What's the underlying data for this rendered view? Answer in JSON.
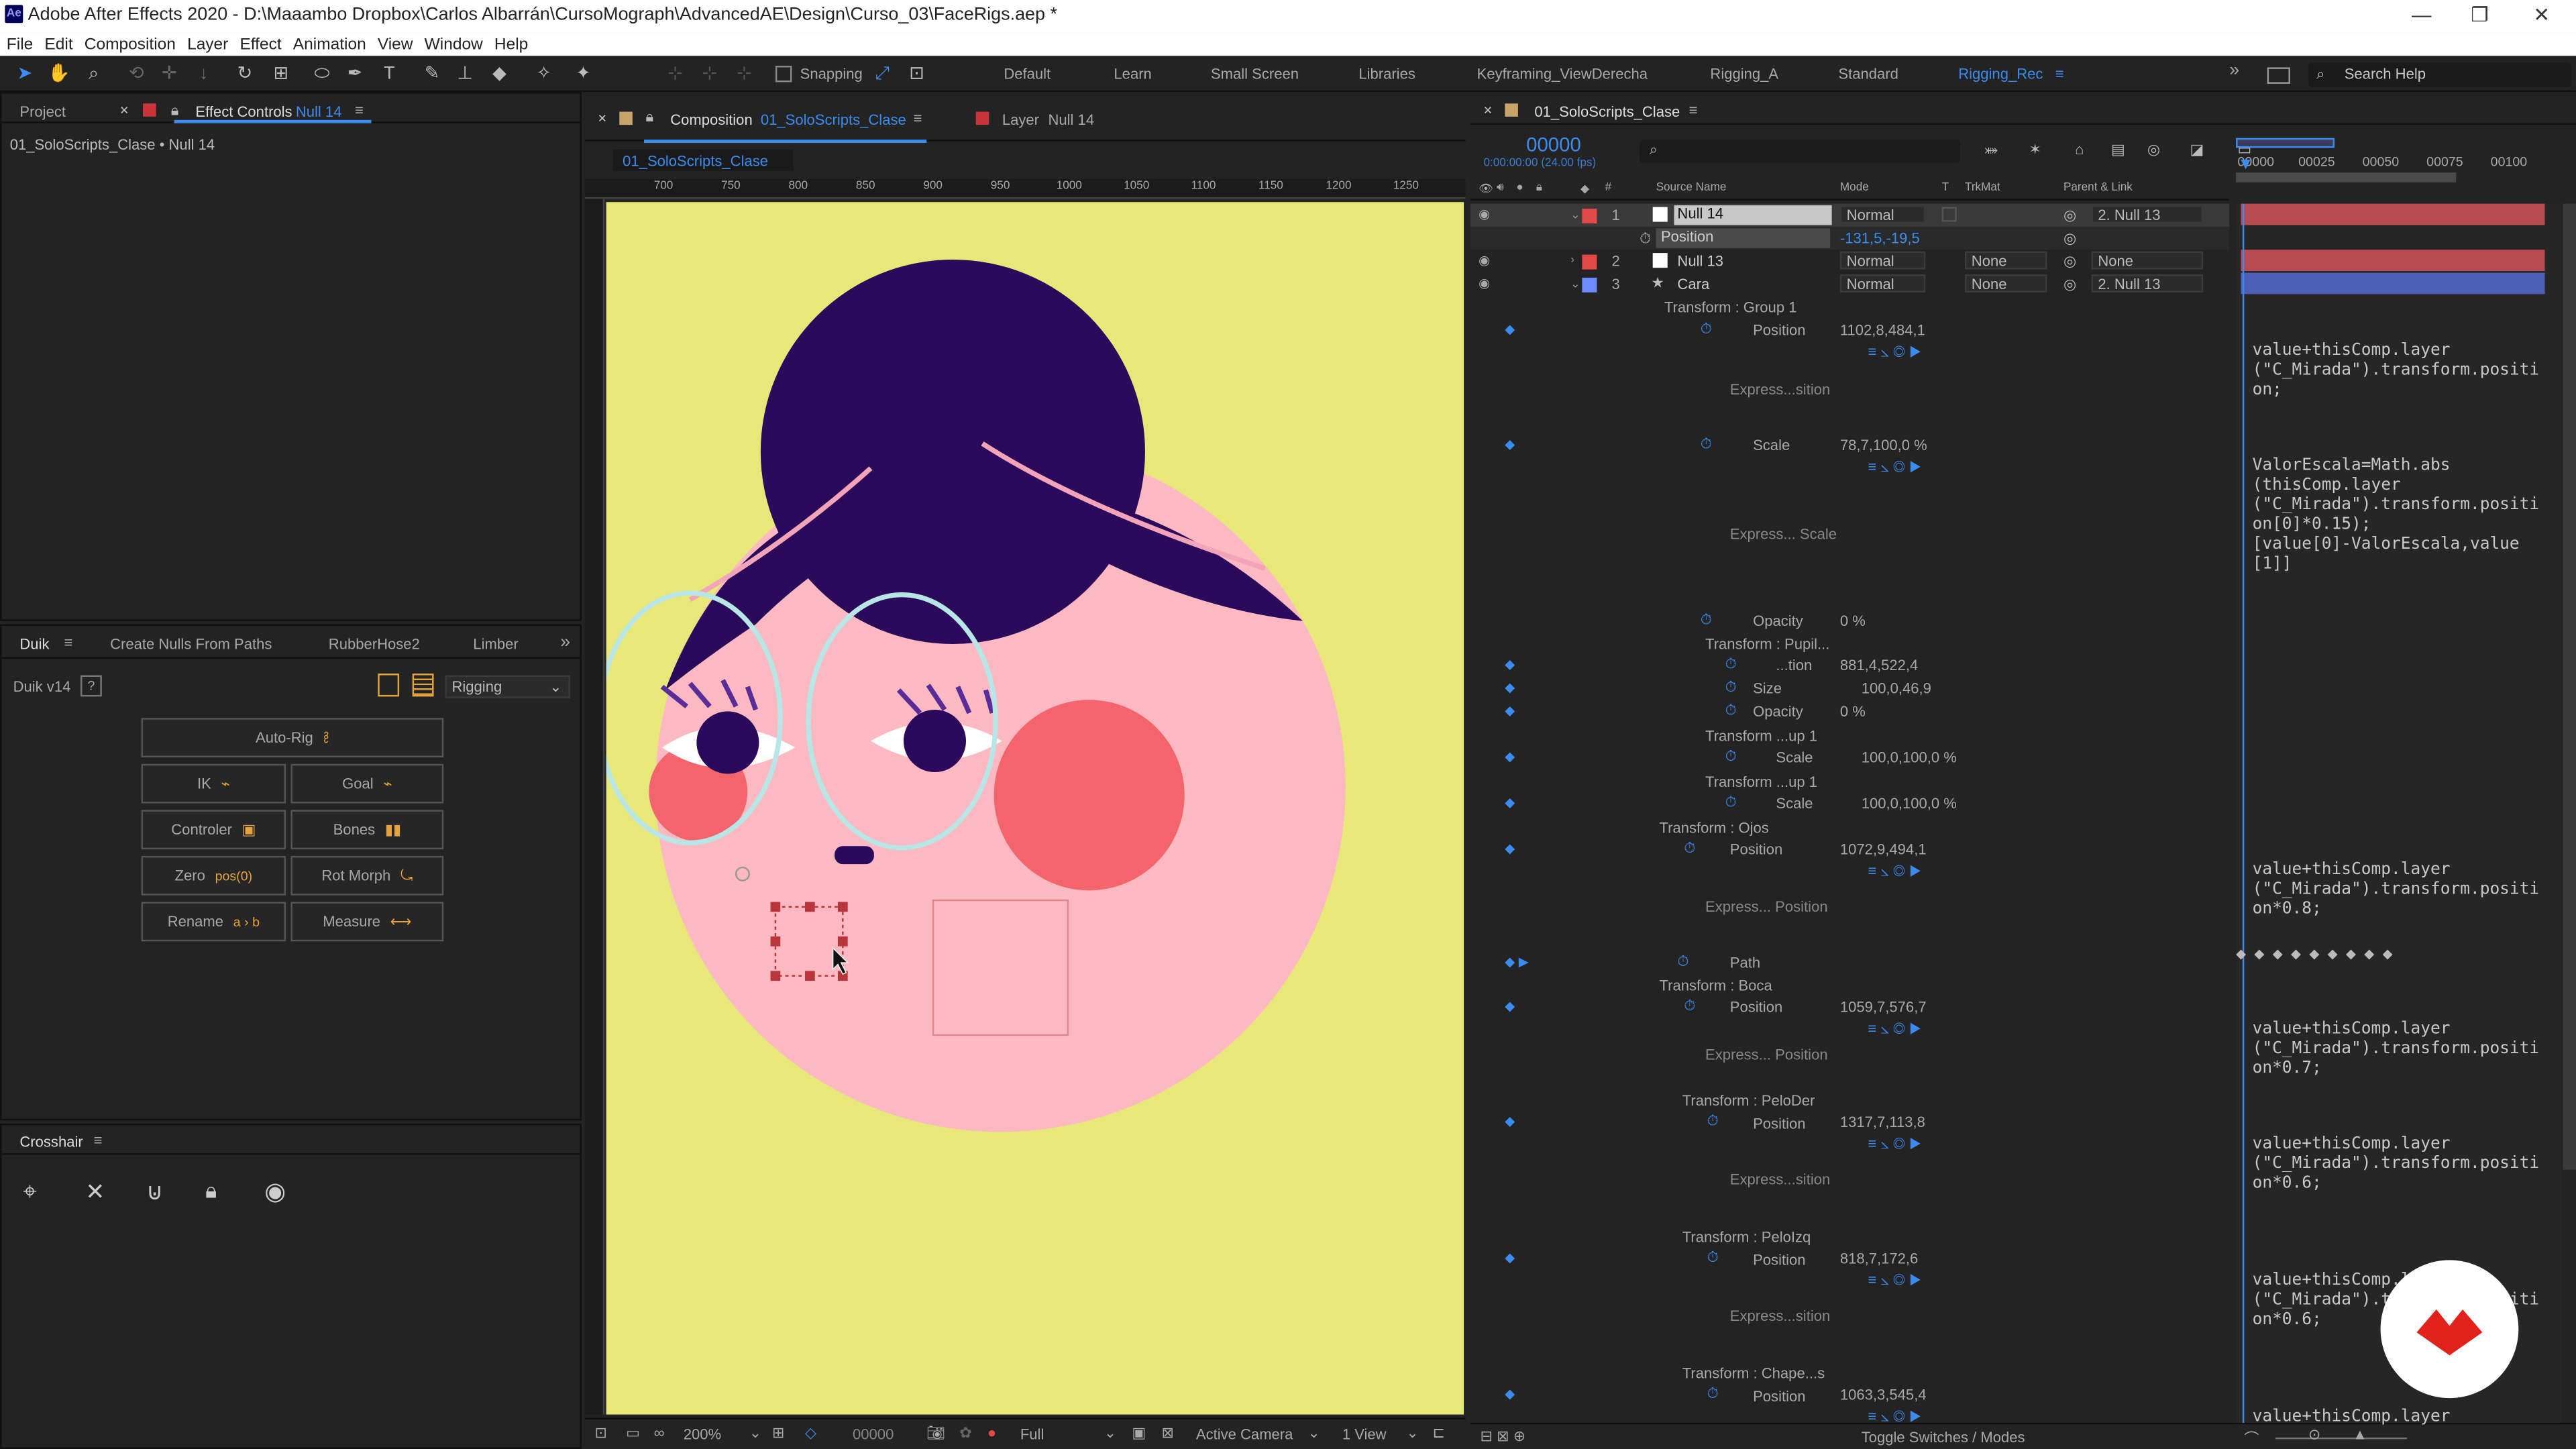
{
  "app": {
    "title": "Adobe After Effects 2020 - D:\\Maaambo Dropbox\\Carlos Albarrán\\CursoMograph\\AdvancedAE\\Design\\Curso_03\\FaceRigs.aep *",
    "logo": "Ae"
  },
  "menu": [
    "File",
    "Edit",
    "Composition",
    "Layer",
    "Effect",
    "Animation",
    "View",
    "Window",
    "Help"
  ],
  "toolbar": {
    "snapping": "Snapping",
    "workspaces": [
      "Default",
      "Learn",
      "Small Screen",
      "Libraries",
      "Keyframing_ViewDerecha",
      "Rigging_A",
      "Standard",
      "Rigging_Rec"
    ],
    "active_workspace": "Rigging_Rec",
    "search_placeholder": "Search Help"
  },
  "left_panel": {
    "tab_project": "Project",
    "tab_effect_controls": "Effect Controls",
    "effect_controls_layer": "Null 14",
    "breadcrumb": "01_SoloScripts_Clase • Null 14"
  },
  "duik": {
    "tabs": [
      "Duik",
      "Create Nulls From Paths",
      "RubberHose2",
      "Limber"
    ],
    "version": "Duik v14",
    "help": "?",
    "mode": "Rigging",
    "buttons": [
      {
        "label": "Auto-Rig",
        "icon": "ꔧ"
      },
      {
        "label": "IK",
        "icon": "⌁"
      },
      {
        "label": "Goal",
        "icon": "⌁"
      },
      {
        "label": "Controler",
        "icon": "▣"
      },
      {
        "label": "Bones",
        "icon": "▮▮"
      },
      {
        "label": "Zero",
        "icon": "pos(0)"
      },
      {
        "label": "Rot Morph",
        "icon": "⤿"
      },
      {
        "label": "Rename",
        "icon": "a › b"
      },
      {
        "label": "Measure",
        "icon": "⟷"
      }
    ]
  },
  "crosshair": {
    "title": "Crosshair"
  },
  "composition": {
    "tab_label": "Composition",
    "comp_name": "01_SoloScripts_Clase",
    "layer_tab": "Layer",
    "layer_name": "Null 14",
    "breadcrumb": "01_SoloScripts_Clase",
    "ruler": [
      "700",
      "750",
      "800",
      "850",
      "900",
      "950",
      "1000",
      "1050",
      "1100",
      "1150",
      "1200",
      "1250"
    ],
    "zoom": "200%",
    "timecode": "00000",
    "resolution": "Full",
    "camera": "Active Camera",
    "views": "1 View"
  },
  "timeline": {
    "comp_name": "01_SoloScripts_Clase",
    "timecode": "00000",
    "fps": "0:00:00:00 (24.00 fps)",
    "ruler": [
      "00000",
      "00025",
      "00050",
      "00075",
      "00100"
    ],
    "headers": {
      "source_name": "Source Name",
      "mode": "Mode",
      "t": "T",
      "trkmat": "TrkMat",
      "parent": "Parent & Link"
    },
    "layers": [
      {
        "num": "1",
        "name": "Null 14",
        "mode": "Normal",
        "trkmat": "",
        "parent": "2. Null 13",
        "color": "#e24a4a"
      },
      {
        "num": "2",
        "name": "Null 13",
        "mode": "Normal",
        "trkmat": "None",
        "parent": "None",
        "color": "#e24a4a"
      },
      {
        "num": "3",
        "name": "Cara",
        "mode": "Normal",
        "trkmat": "None",
        "parent": "2. Null 13",
        "color": "#6d8bff"
      }
    ],
    "position_label": "Position",
    "position_value": "-131,5,-19,5",
    "props": {
      "g1": "Transform : Group 1",
      "pos": "Position",
      "pos_val": "1102,8,484,1",
      "expr_pos": "Express...sition",
      "scale": "Scale",
      "scale_val": "78,7,100,0 %",
      "expr_scale": "Express... Scale",
      "opacity": "Opacity",
      "opacity_val": "0 %",
      "pupil": "Transform : Pupil...",
      "tion": "...tion",
      "tion_val": "881,4,522,4",
      "size": "Size",
      "size_val": "100,0,46,9",
      "opacity2_val": "0 %",
      "up1": "Transform ...up 1",
      "scale_100": "100,0,100,0 %",
      "ojos": "Transform : Ojos",
      "ojos_val": "1072,9,494,1",
      "expr_position": "Express... Position",
      "path": "Path",
      "boca": "Transform : Boca",
      "boca_val": "1059,7,576,7",
      "peloder": "Transform : PeloDer",
      "peloder_val": "1317,7,113,8",
      "peloizq": "Transform : PeloIzq",
      "peloizq_val": "818,7,172,6",
      "chape": "Transform : Chape...s",
      "chape_val": "1063,3,545,4"
    },
    "expressions": {
      "e1": "value+thisComp.layer\n(\"C_Mirada\").transform.positi\non;",
      "e2": "ValorEscala=Math.abs\n(thisComp.layer\n(\"C_Mirada\").transform.positi\non[0]*0.15);\n[value[0]-ValorEscala,value\n[1]]",
      "e3": "value+thisComp.layer\n(\"C_Mirada\").transform.positi\non*0.8;",
      "e4": "value+thisComp.layer\n(\"C_Mirada\").transform.positi\non*0.7;",
      "e5": "value+thisComp.layer\n(\"C_Mirada\").transform.positi\non*0.6;",
      "e6": "value+thisComp.layer\n(\"C_Mirada\").transform.positi\non*0.6;",
      "e7": "value+thisComp.layer"
    },
    "toggle": "Toggle Switches / Modes"
  }
}
